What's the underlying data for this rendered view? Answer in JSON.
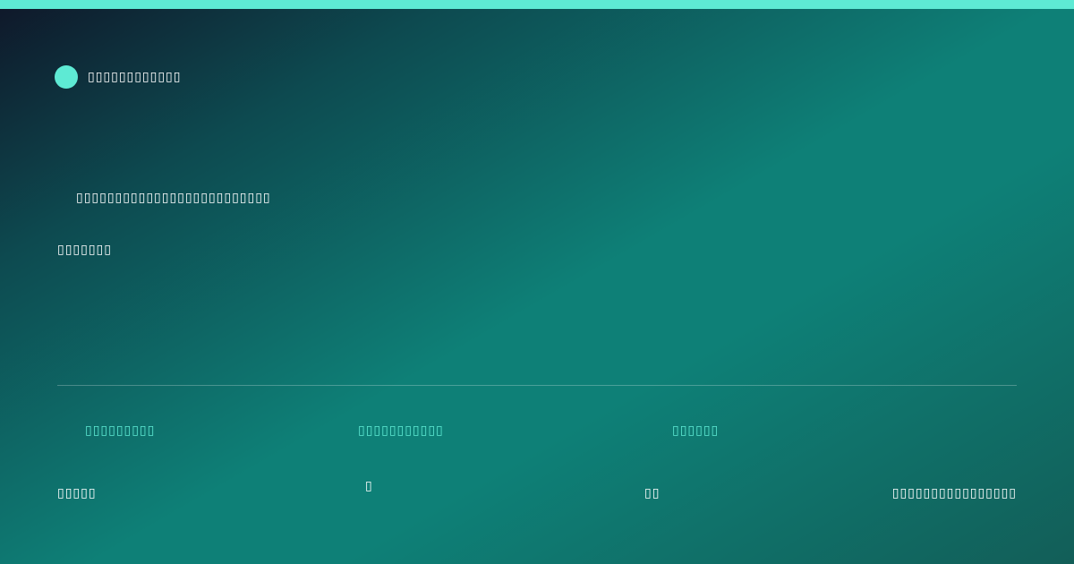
{
  "colors": {
    "accent": "#5eead4",
    "text": "#ffffff",
    "background_start": "#0f1729",
    "background_mid": "#0e8077",
    "background_end": "#125e58"
  },
  "header": {
    "brand_icon": "brand-dot-icon",
    "brand_name": "▯▯▯▯▯▯▯▯▯▯▯▯"
  },
  "hero": {
    "headline": "▯▯▯▯▯▯▯▯▯▯▯▯▯▯▯▯▯▯▯▯▯▯▯▯▯",
    "subheadline": "▯▯▯▯▯▯▯"
  },
  "stats": [
    {
      "label": "▯▯▯▯▯▯▯▯▯",
      "value": "▯▯▯▯▯"
    },
    {
      "label": "▯▯▯▯▯▯▯▯▯▯▯",
      "value": "▯"
    },
    {
      "label": "▯▯▯▯▯▯",
      "value": "▯▯"
    }
  ],
  "footer": {
    "right_text": "▯▯▯▯▯▯▯▯▯▯▯▯▯▯▯▯"
  }
}
